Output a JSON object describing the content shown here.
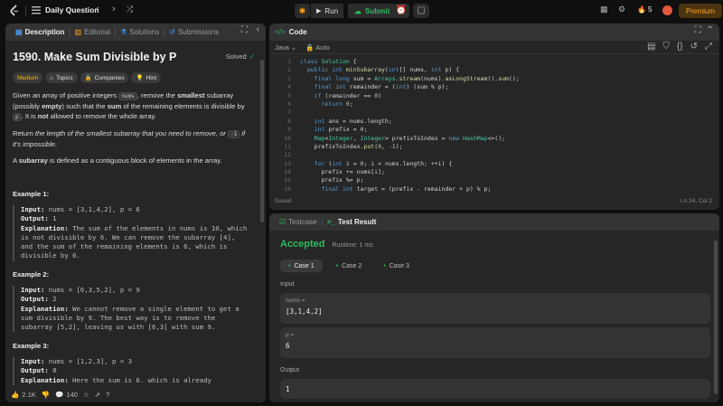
{
  "topbar": {
    "title": "Daily Question",
    "run": "Run",
    "submit": "Submit",
    "streak": "5",
    "premium": "Premium",
    "accent_orange": "#ffa116",
    "accent_green": "#2cbb5d"
  },
  "left_tabs": [
    "Description",
    "Editorial",
    "Solutions",
    "Submissions"
  ],
  "problem": {
    "title": "1590. Make Sum Divisible by P",
    "status": "Solved",
    "difficulty": "Medium",
    "tags": [
      "Topics",
      "Companies",
      "Hint"
    ],
    "p1_a": "Given an array of positive integers ",
    "p1_code1": "nums",
    "p1_b": ", remove the ",
    "p1_bold1": "smallest",
    "p1_c": " subarray (possibly ",
    "p1_bold2": "empty",
    "p1_d": ") such that the ",
    "p1_bold3": "sum",
    "p1_e": " of the remaining elements is divisible by ",
    "p1_code2": "p",
    "p1_f": ". It is ",
    "p1_bold4": "not",
    "p1_g": " allowed to remove the whole array.",
    "p2_a": "Return ",
    "p2_italic": "the length of the smallest subarray that you need to remove, or ",
    "p2_code": "-1",
    "p2_b": " if it's impossible.",
    "p3_a": "A ",
    "p3_bold": "subarray",
    "p3_b": " is defined as a contiguous block of elements in the array."
  },
  "examples": [
    {
      "title": "Example 1:",
      "input_label": "Input:",
      "input": " nums = [3,1,4,2], p = 6",
      "output_label": "Output:",
      "output": " 1",
      "expl_label": "Explanation:",
      "expl": " The sum of the elements in nums is 10, which\nis not divisible by 6. We can remove the subarray [4],\nand the sum of the remaining elements is 6, which is\ndivisible by 6."
    },
    {
      "title": "Example 2:",
      "input_label": "Input:",
      "input": " nums = [6,3,5,2], p = 9",
      "output_label": "Output:",
      "output": " 2",
      "expl_label": "Explanation:",
      "expl": " We cannot remove a single element to get a\nsum divisible by 9. The best way is to remove the\nsubarray [5,2], leaving us with [6,3] with sum 9."
    },
    {
      "title": "Example 3:",
      "input_label": "Input:",
      "input": " nums = [1,2,3], p = 3",
      "output_label": "Output:",
      "output": " 0",
      "expl_label": "Explanation:",
      "expl": " Here the sum is 6. which is already"
    }
  ],
  "left_footer": {
    "likes": "2.1K",
    "comments": "140"
  },
  "code_panel": {
    "title": "Code",
    "language": "Java",
    "mode": "Auto",
    "saved": "Saved",
    "cursor": "Ln 24, Col 2",
    "lines": [
      [
        [
          "kw",
          "class "
        ],
        [
          "ty",
          "Solution "
        ],
        [
          "tx",
          "{"
        ]
      ],
      [
        [
          "tx",
          "  "
        ],
        [
          "kw",
          "public int "
        ],
        [
          "fn",
          "minSubarray"
        ],
        [
          "tx",
          "("
        ],
        [
          "kw",
          "int"
        ],
        [
          "tx",
          "[] nums, "
        ],
        [
          "kw",
          "int "
        ],
        [
          "tx",
          "p) {"
        ]
      ],
      [
        [
          "tx",
          "    "
        ],
        [
          "kw",
          "final long "
        ],
        [
          "tx",
          "sum = "
        ],
        [
          "ty",
          "Arrays"
        ],
        [
          "tx",
          "."
        ],
        [
          "fn",
          "stream"
        ],
        [
          "tx",
          "(nums)."
        ],
        [
          "fn",
          "asLongStream"
        ],
        [
          "tx",
          "()."
        ],
        [
          "fn",
          "sum"
        ],
        [
          "tx",
          "();"
        ]
      ],
      [
        [
          "tx",
          "    "
        ],
        [
          "kw",
          "final int "
        ],
        [
          "tx",
          "remainder = ("
        ],
        [
          "kw",
          "int"
        ],
        [
          "tx",
          ") (sum % p);"
        ]
      ],
      [
        [
          "tx",
          "    "
        ],
        [
          "kw",
          "if "
        ],
        [
          "tx",
          "(remainder == "
        ],
        [
          "nm",
          "0"
        ],
        [
          "tx",
          ")"
        ]
      ],
      [
        [
          "tx",
          "      "
        ],
        [
          "kw",
          "return "
        ],
        [
          "nm",
          "0"
        ],
        [
          "tx",
          ";"
        ]
      ],
      [
        [
          "tx",
          ""
        ]
      ],
      [
        [
          "tx",
          "    "
        ],
        [
          "kw",
          "int "
        ],
        [
          "tx",
          "ans = nums.length;"
        ]
      ],
      [
        [
          "tx",
          "    "
        ],
        [
          "kw",
          "int "
        ],
        [
          "tx",
          "prefix = "
        ],
        [
          "nm",
          "0"
        ],
        [
          "tx",
          ";"
        ]
      ],
      [
        [
          "tx",
          "    "
        ],
        [
          "ty",
          "Map"
        ],
        [
          "tx",
          "<"
        ],
        [
          "ty",
          "Integer"
        ],
        [
          "tx",
          ", "
        ],
        [
          "ty",
          "Integer"
        ],
        [
          "tx",
          "> prefixToIndex = "
        ],
        [
          "kw",
          "new "
        ],
        [
          "ty",
          "HashMap"
        ],
        [
          "tx",
          "<>();"
        ]
      ],
      [
        [
          "tx",
          "    prefixToIndex."
        ],
        [
          "fn",
          "put"
        ],
        [
          "tx",
          "("
        ],
        [
          "nm",
          "0"
        ],
        [
          "tx",
          ", -"
        ],
        [
          "nm",
          "1"
        ],
        [
          "tx",
          ");"
        ]
      ],
      [
        [
          "tx",
          ""
        ]
      ],
      [
        [
          "tx",
          "    "
        ],
        [
          "kw",
          "for "
        ],
        [
          "tx",
          "("
        ],
        [
          "kw",
          "int "
        ],
        [
          "tx",
          "i = "
        ],
        [
          "nm",
          "0"
        ],
        [
          "tx",
          "; i < nums.length; ++i) {"
        ]
      ],
      [
        [
          "tx",
          "      prefix += nums[i];"
        ]
      ],
      [
        [
          "tx",
          "      prefix %= p;"
        ]
      ],
      [
        [
          "tx",
          "      "
        ],
        [
          "kw",
          "final int "
        ],
        [
          "tx",
          "target = (prefix - remainder + p) % p;"
        ]
      ]
    ]
  },
  "result_panel": {
    "tab1": "Testcase",
    "tab2": "Test Result",
    "status": "Accepted",
    "runtime": "Runtime: 1 ms",
    "cases": [
      "Case 1",
      "Case 2",
      "Case 3"
    ],
    "input_label": "Input",
    "var1_name": "nums =",
    "var1_value": "[3,1,4,2]",
    "var2_name": "p =",
    "var2_value": "6",
    "output_label": "Output",
    "output_value": "1"
  }
}
